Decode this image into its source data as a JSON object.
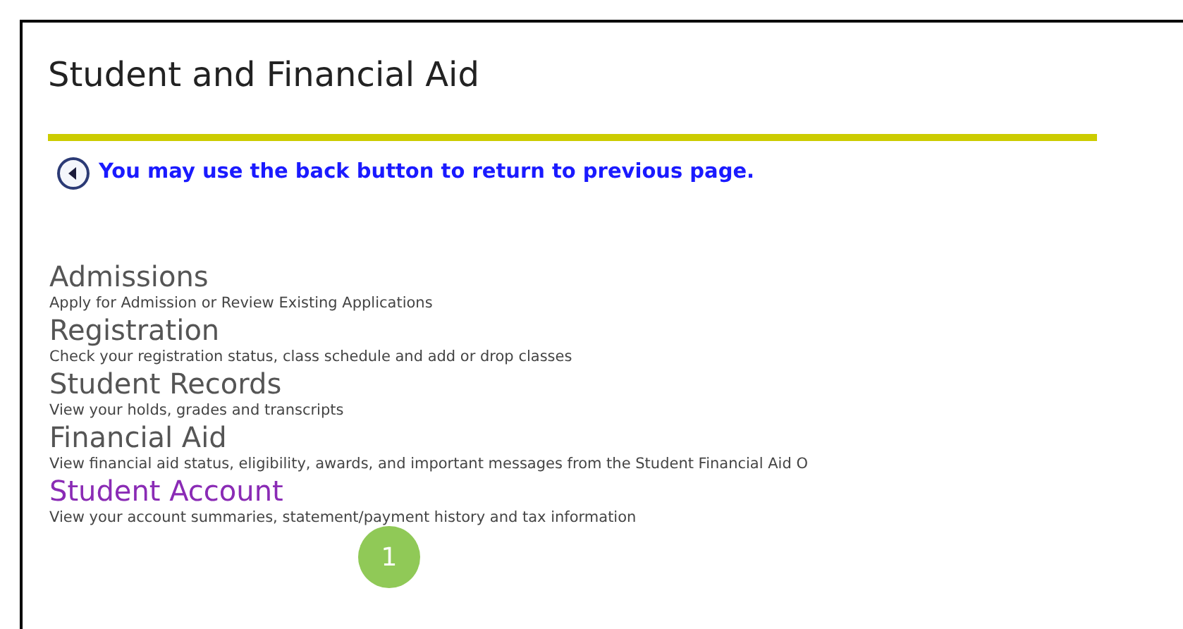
{
  "page": {
    "title": "Student and Financial Aid"
  },
  "back_link": {
    "text": "You may use the back button to return to previous page."
  },
  "menu": [
    {
      "label": "Admissions",
      "description": "Apply for Admission or Review Existing Applications",
      "visited": false
    },
    {
      "label": "Registration",
      "description": "Check your registration status, class schedule and add or drop classes",
      "visited": false
    },
    {
      "label": "Student Records",
      "description": "View your holds, grades and transcripts",
      "visited": false
    },
    {
      "label": "Financial Aid",
      "description": "View financial aid status, eligibility, awards, and important messages from the Student Financial Aid O",
      "visited": false
    },
    {
      "label": "Student Account",
      "description": "View your account summaries, statement/payment history and tax information",
      "visited": true
    }
  ],
  "callout": {
    "text": "1"
  }
}
